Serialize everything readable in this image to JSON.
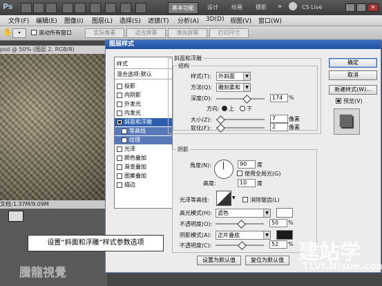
{
  "app": {
    "logo": "Ps",
    "workspaces": [
      "基本功能",
      "设计",
      "绘画",
      "摄影"
    ],
    "cs_live": "CS Live",
    "menu": [
      "文件(F)",
      "编辑(E)",
      "图像(I)",
      "图层(L)",
      "选择(S)",
      "滤镜(T)",
      "分析(A)",
      "3D(D)",
      "视图(V)",
      "窗口(W)"
    ],
    "options": {
      "scroll_all_label": "滚动所有窗口",
      "btn_actual": "实际像素",
      "btn_fit": "适合屏幕",
      "btn_fill": "填充屏幕",
      "btn_print": "打印尺寸"
    },
    "doc_tab": "psd @ 50% (图层 2, RGB/8)",
    "status": "文档:1.37M/9.09M"
  },
  "dialog": {
    "title": "图层样式",
    "styles_header": "样式",
    "blend_header": "混合选项:默认",
    "styles": [
      {
        "label": "投影",
        "checked": false,
        "state": "normal"
      },
      {
        "label": "内阴影",
        "checked": false,
        "state": "normal"
      },
      {
        "label": "外发光",
        "checked": false,
        "state": "normal"
      },
      {
        "label": "内发光",
        "checked": false,
        "state": "normal"
      },
      {
        "label": "斜面和浮雕",
        "checked": true,
        "state": "selected"
      },
      {
        "label": "等高线",
        "checked": false,
        "state": "sub"
      },
      {
        "label": "纹理",
        "checked": false,
        "state": "sub"
      },
      {
        "label": "光泽",
        "checked": false,
        "state": "normal"
      },
      {
        "label": "颜色叠加",
        "checked": false,
        "state": "normal"
      },
      {
        "label": "渐变叠加",
        "checked": false,
        "state": "normal"
      },
      {
        "label": "图案叠加",
        "checked": false,
        "state": "normal"
      },
      {
        "label": "描边",
        "checked": false,
        "state": "normal"
      }
    ],
    "bevel": {
      "section_title": "斜面和浮雕",
      "structure_title": "结构",
      "style_label": "样式(T):",
      "style_value": "外斜面",
      "technique_label": "方法(Q):",
      "technique_value": "雕刻柔和",
      "depth_label": "深度(D):",
      "depth_value": "174",
      "depth_unit": "%",
      "direction_label": "方向:",
      "dir_up": "上",
      "dir_down": "下",
      "size_label": "大小(Z):",
      "size_value": "7",
      "size_unit": "像素",
      "soften_label": "软化(F):",
      "soften_value": "2",
      "soften_unit": "像素"
    },
    "shading": {
      "title": "阴影",
      "angle_label": "角度(N):",
      "angle_value": "90",
      "angle_unit": "度",
      "global_light_label": "使用全局光(G)",
      "altitude_label": "高度:",
      "altitude_value": "10",
      "altitude_unit": "度",
      "gloss_label": "光泽等高线:",
      "anti_alias_label": "消除锯齿(L)",
      "highlight_label": "高光模式(H):",
      "highlight_value": "滤色",
      "highlight_color": "#ffffff",
      "h_opacity_label": "不透明度(O):",
      "h_opacity_value": "50",
      "shadow_label": "阴影模式(A):",
      "shadow_value": "正片叠底",
      "shadow_color": "#1a1a1a",
      "s_opacity_label": "不透明度(C):",
      "s_opacity_value": "52",
      "pct": "%"
    },
    "btn_default_set": "设置为默认值",
    "btn_reset": "复位为默认值",
    "ok": "确定",
    "cancel": "取消",
    "new_style": "新建样式(W)...",
    "preview_label": "预览(V)"
  },
  "caption": "设置“斜面和浮雕”样式参数选项",
  "watermarks": {
    "left": "騰龍視覺",
    "right": "建站学",
    "url": "TLVI.NIxue.com"
  }
}
